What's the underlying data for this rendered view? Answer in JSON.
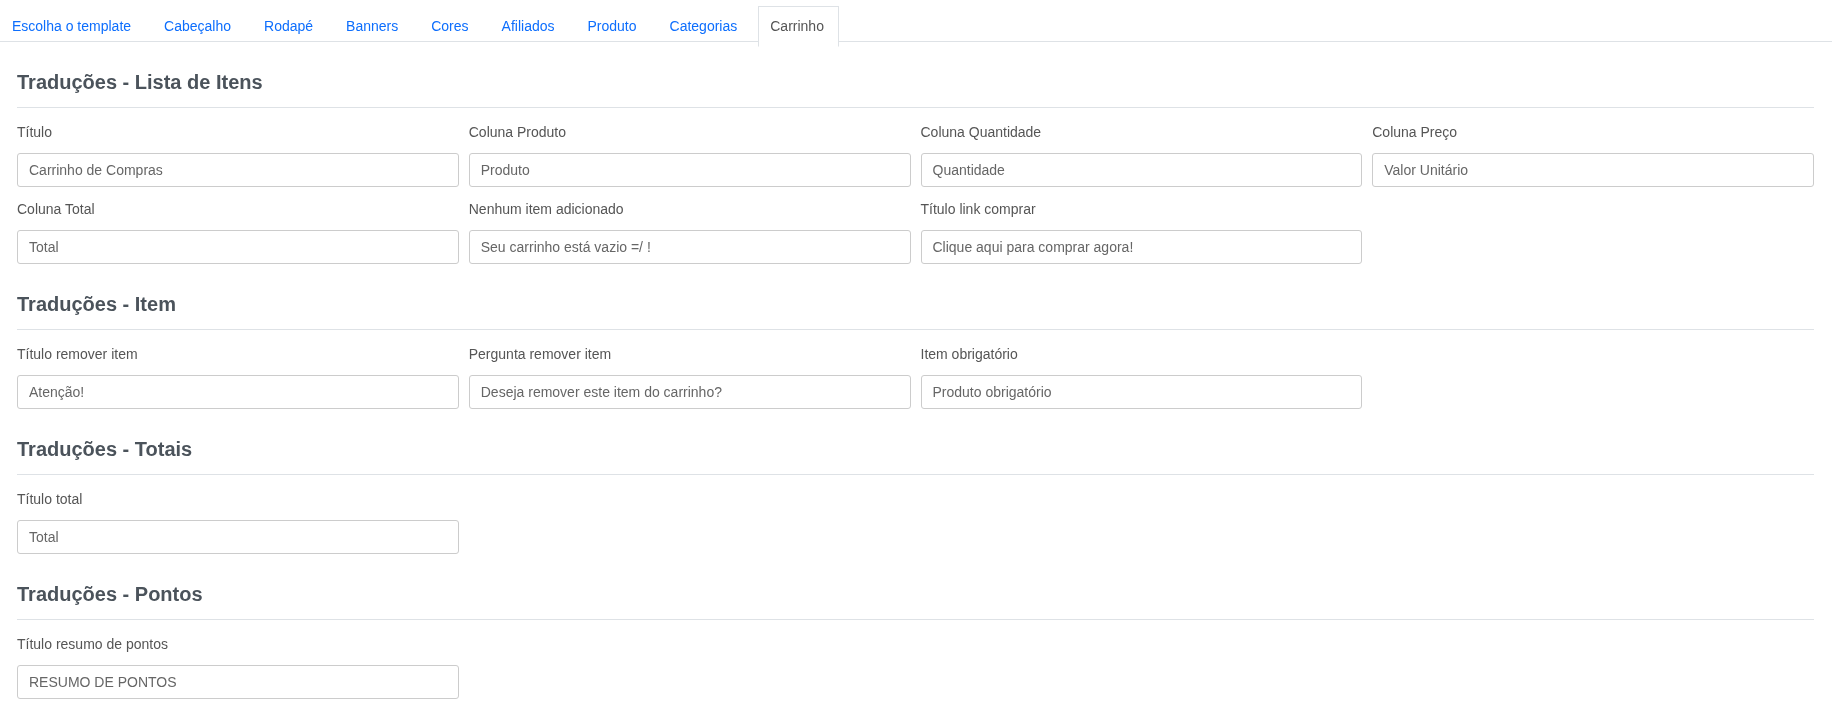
{
  "tabs": [
    {
      "label": "Escolha o template",
      "selected": false
    },
    {
      "label": "Cabeçalho",
      "selected": false
    },
    {
      "label": "Rodapé",
      "selected": false
    },
    {
      "label": "Banners",
      "selected": false
    },
    {
      "label": "Cores",
      "selected": false
    },
    {
      "label": "Afiliados",
      "selected": false
    },
    {
      "label": "Produto",
      "selected": false
    },
    {
      "label": "Categorias",
      "selected": false
    },
    {
      "label": "Carrinho",
      "selected": true
    }
  ],
  "sections": [
    {
      "title": "Traduções - Lista de Itens",
      "fields": [
        {
          "label": "Título",
          "value": "Carrinho de Compras"
        },
        {
          "label": "Coluna Produto",
          "value": "Produto"
        },
        {
          "label": "Coluna Quantidade",
          "value": "Quantidade"
        },
        {
          "label": "Coluna Preço",
          "value": "Valor Unitário"
        },
        {
          "label": "Coluna Total",
          "value": "Total"
        },
        {
          "label": "Nenhum item adicionado",
          "value": "Seu carrinho está vazio =/ !"
        },
        {
          "label": "Título link comprar",
          "value": "Clique aqui para comprar agora!"
        }
      ]
    },
    {
      "title": "Traduções - Item",
      "fields": [
        {
          "label": "Título remover item",
          "value": "Atenção!"
        },
        {
          "label": "Pergunta remover item",
          "value": "Deseja remover este item do carrinho?"
        },
        {
          "label": "Item obrigatório",
          "value": "Produto obrigatório"
        }
      ]
    },
    {
      "title": "Traduções - Totais",
      "fields": [
        {
          "label": "Título total",
          "value": "Total"
        }
      ]
    },
    {
      "title": "Traduções - Pontos",
      "fields": [
        {
          "label": "Título resumo de pontos",
          "value": "RESUMO DE PONTOS"
        }
      ]
    }
  ]
}
